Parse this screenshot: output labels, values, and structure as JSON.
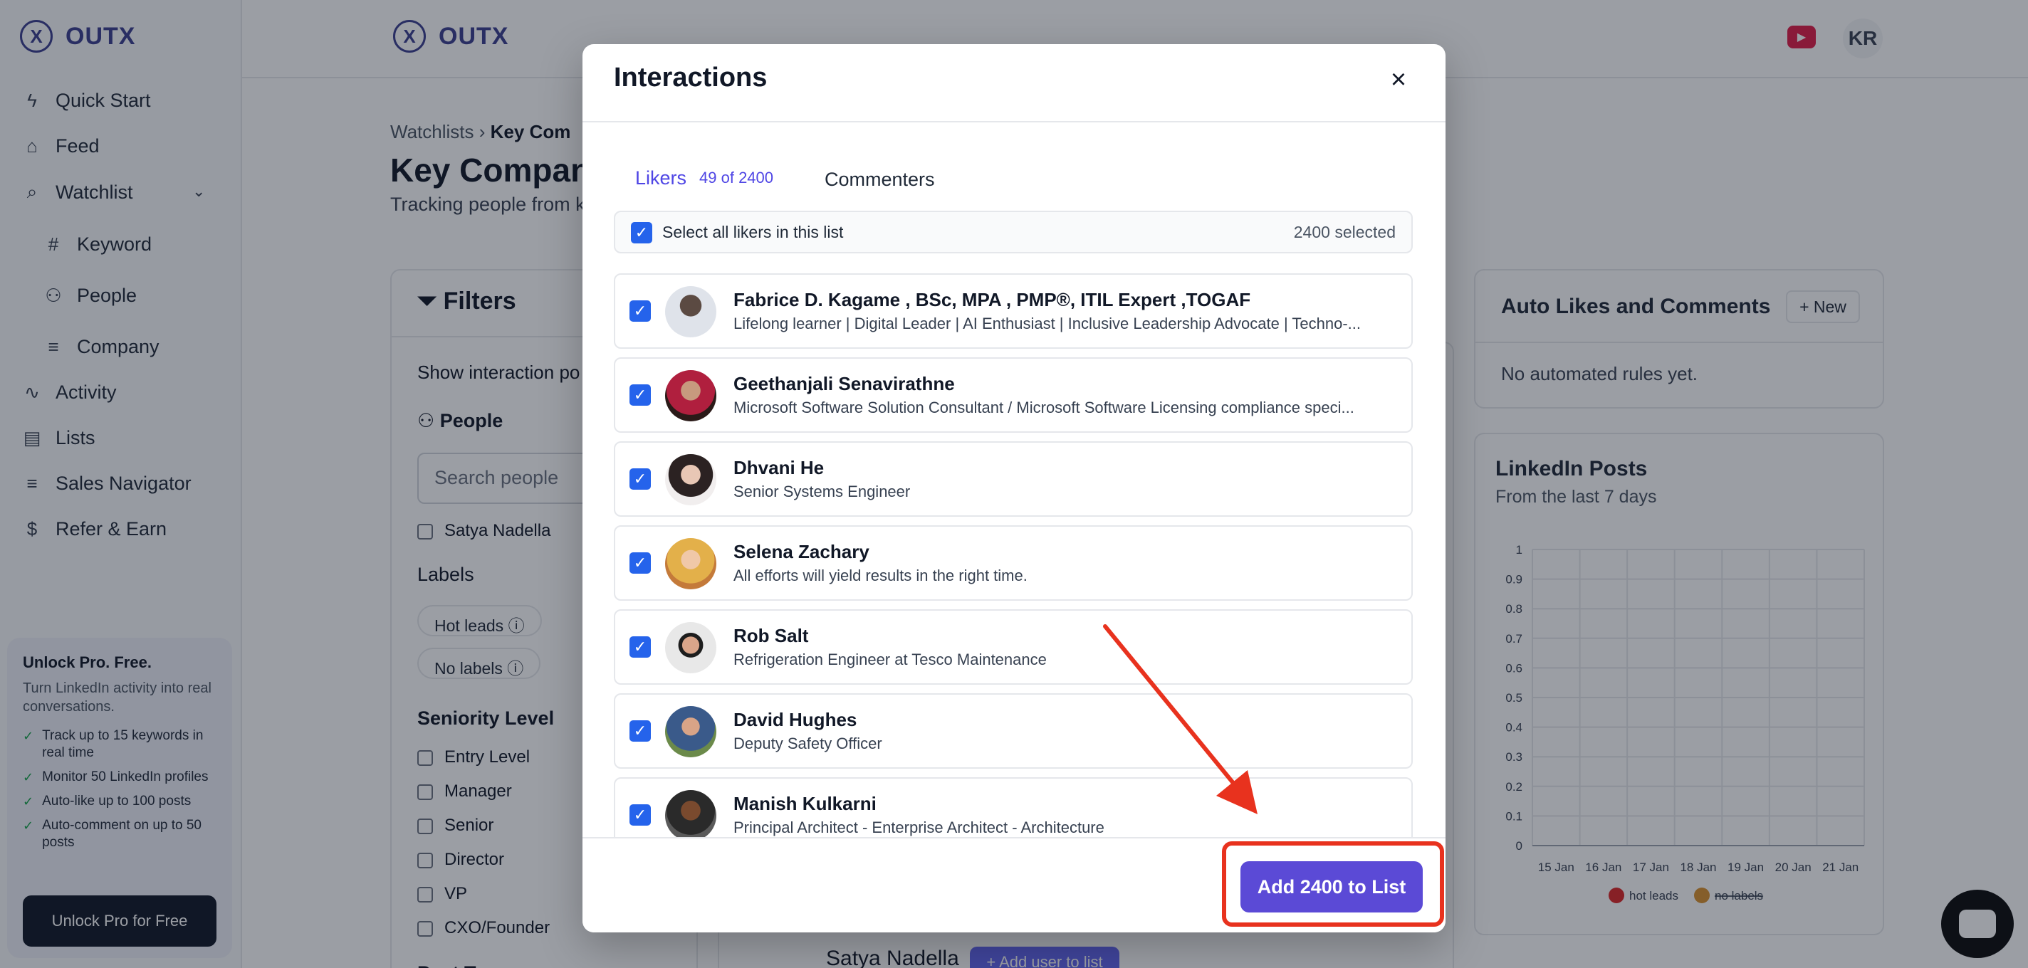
{
  "app": {
    "brand": "OUTX",
    "logo_letter": "X",
    "avatar_initials": "KR",
    "youtube_icon": "youtube-icon"
  },
  "sidebar": {
    "items": [
      {
        "label": "Quick Start",
        "icon": "bolt-icon"
      },
      {
        "label": "Feed",
        "icon": "home-icon"
      },
      {
        "label": "Watchlist",
        "icon": "search-icon"
      },
      {
        "label": "Keyword",
        "icon": "hash-icon"
      },
      {
        "label": "People",
        "icon": "users-icon"
      },
      {
        "label": "Company",
        "icon": "database-icon"
      },
      {
        "label": "Activity",
        "icon": "activity-icon"
      },
      {
        "label": "Lists",
        "icon": "file-icon"
      },
      {
        "label": "Sales Navigator",
        "icon": "database-icon"
      },
      {
        "label": "Refer & Earn",
        "icon": "dollar-icon"
      }
    ],
    "promo": {
      "title": "Unlock Pro. Free.",
      "text": "Turn LinkedIn activity into real conversations.",
      "bullets": [
        "Track up to 15 keywords in real time",
        "Monitor 50 LinkedIn profiles",
        "Auto-like up to 100 posts",
        "Auto-comment on up to 50 posts"
      ],
      "button": "Unlock Pro for Free"
    }
  },
  "page": {
    "breadcrumb_root": "Watchlists",
    "breadcrumb_current": "Key Com",
    "title": "Key Compani",
    "subtitle": "Tracking people from k"
  },
  "filters": {
    "title": "Filters",
    "show_interaction": "Show interaction po",
    "people_label": "People",
    "search_placeholder": "Search people",
    "person_option": "Satya Nadella",
    "labels_title": "Labels",
    "label_chips": [
      "Hot leads",
      "No labels"
    ],
    "seniority_title": "Seniority Level",
    "seniority_options": [
      "Entry Level",
      "Manager",
      "Senior",
      "Director",
      "VP",
      "CXO/Founder"
    ],
    "next_section": "Post Ty"
  },
  "middle": {
    "row_name": "Satya Nadella",
    "row_action": "+ Add user to list"
  },
  "auto": {
    "title": "Auto Likes and Comments",
    "new_button": "New",
    "empty": "No automated rules yet."
  },
  "posts": {
    "title": "LinkedIn Posts",
    "subtitle": "From the last 7 days"
  },
  "chart_data": {
    "type": "line",
    "x": [
      "15 Jan",
      "16 Jan",
      "17 Jan",
      "18 Jan",
      "19 Jan",
      "20 Jan",
      "21 Jan"
    ],
    "series": [
      {
        "name": "hot leads",
        "values": [],
        "color": "#dc2626"
      },
      {
        "name": "no labels",
        "values": [],
        "color": "#d9922e"
      }
    ],
    "yticks": [
      "0",
      "0.1",
      "0.2",
      "0.3",
      "0.4",
      "0.5",
      "0.6",
      "0.7",
      "0.8",
      "0.9",
      "1"
    ],
    "ylim": [
      0,
      1
    ],
    "grid": true,
    "legend": "bottom"
  },
  "modal": {
    "title": "Interactions",
    "tab_likers": "Likers",
    "tab_likers_count": "49 of 2400",
    "tab_commenters": "Commenters",
    "select_all": "Select all likers in this list",
    "selected_count": "2400 selected",
    "likers": [
      {
        "name": "Fabrice D. Kagame , BSc, MPA , PMP®, ITIL Expert ,TOGAF",
        "headline": "Lifelong learner | Digital Leader | AI Enthusiast | Inclusive Leadership Advocate | Techno-...",
        "checked": true
      },
      {
        "name": "Geethanjali Senavirathne",
        "headline": "Microsoft Software Solution Consultant / Microsoft Software Licensing compliance speci...",
        "checked": true
      },
      {
        "name": "Dhvani He",
        "headline": "Senior Systems Engineer",
        "checked": true
      },
      {
        "name": "Selena Zachary",
        "headline": "All efforts will yield results in the right time.",
        "checked": true
      },
      {
        "name": "Rob Salt",
        "headline": "Refrigeration Engineer at Tesco Maintenance",
        "checked": true
      },
      {
        "name": "David Hughes",
        "headline": "Deputy Safety Officer",
        "checked": true
      },
      {
        "name": "Manish Kulkarni",
        "headline": "Principal Architect - Enterprise Architect - Architecture",
        "checked": true
      }
    ],
    "add_button": "Add 2400 to List"
  },
  "colors": {
    "brand": "#3b3f8f",
    "accent": "#5b4ad6",
    "tab_active": "#4f46e5",
    "checkbox": "#2563eb",
    "annotation": "#e8321e"
  }
}
